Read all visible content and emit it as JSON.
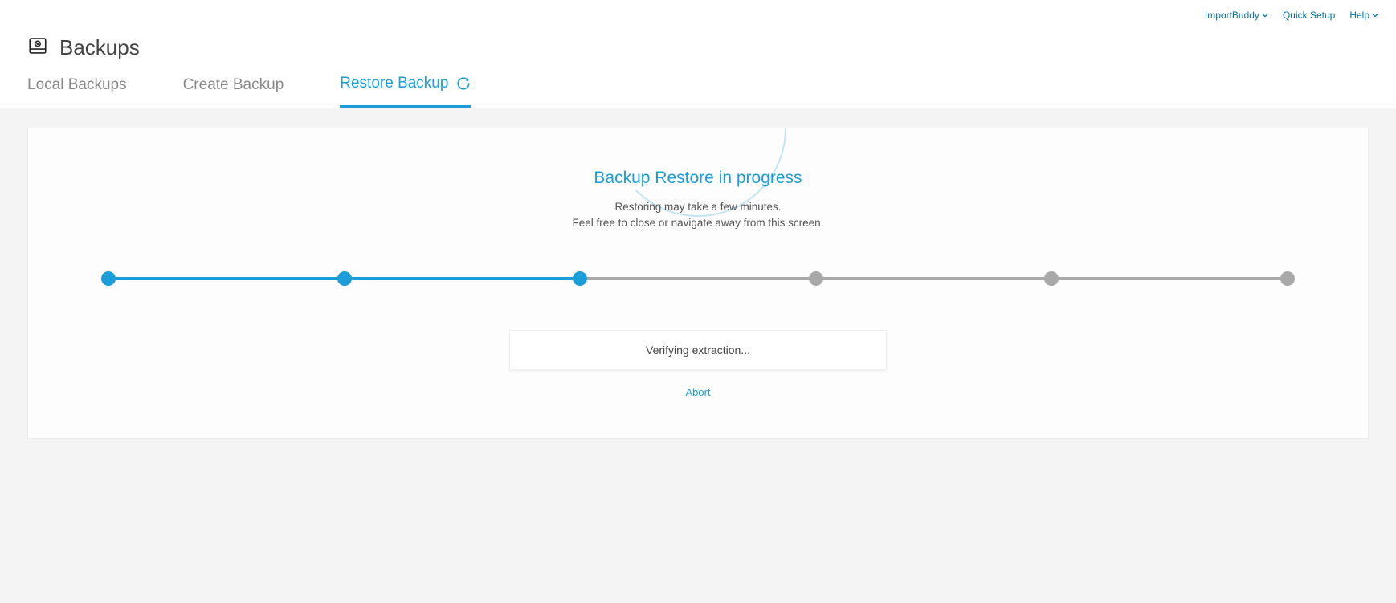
{
  "topLinks": {
    "importBuddy": "ImportBuddy",
    "quickSetup": "Quick Setup",
    "help": "Help"
  },
  "pageTitle": "Backups",
  "tabs": {
    "local": "Local Backups",
    "create": "Create Backup",
    "restore": "Restore Backup"
  },
  "progress": {
    "title": "Backup Restore in progress",
    "line1": "Restoring may take a few minutes.",
    "line2": "Feel free to close or navigate away from this screen.",
    "totalSteps": 6,
    "currentStep": 3,
    "statusMessage": "Verifying extraction...",
    "abortLabel": "Abort"
  },
  "colors": {
    "accent": "#1a9dd8",
    "muted": "#a9a9a9"
  }
}
